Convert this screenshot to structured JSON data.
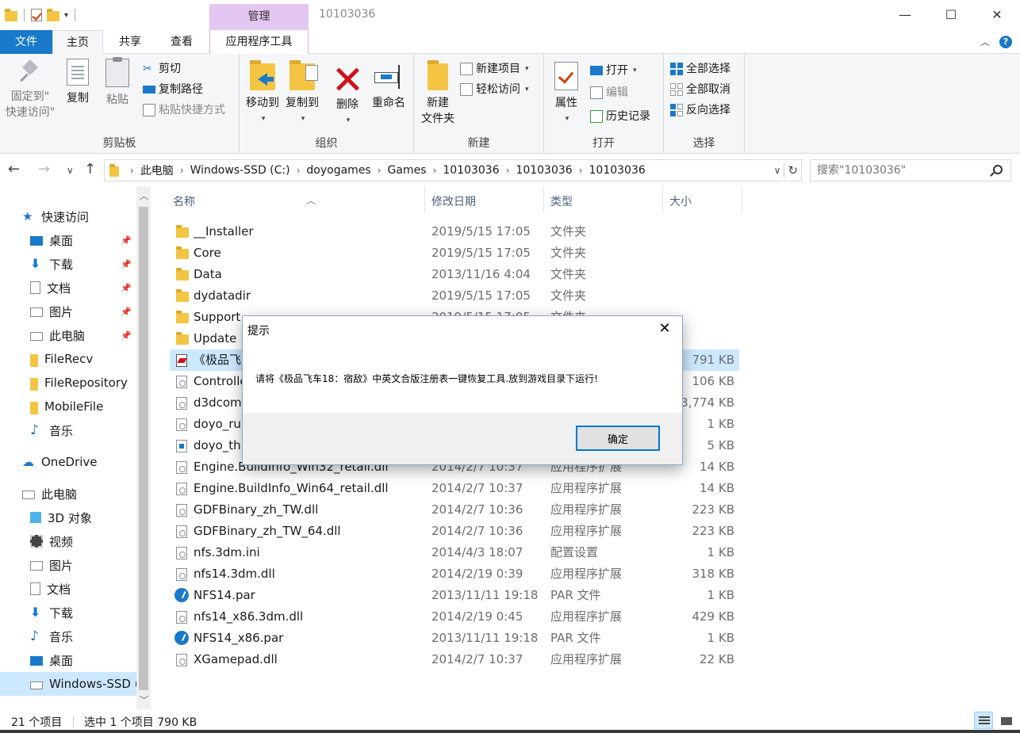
{
  "window": {
    "title": "10103036",
    "context_tab_header": "管理",
    "controls": {
      "minimize": "—",
      "maximize": "☐",
      "close": "✕"
    }
  },
  "ribbon_tabs": [
    {
      "label": "文件"
    },
    {
      "label": "主页"
    },
    {
      "label": "共享"
    },
    {
      "label": "查看"
    },
    {
      "label": "应用程序工具"
    }
  ],
  "ribbon": {
    "clipboard": {
      "label": "剪贴板",
      "pin_line1": "固定到\"",
      "pin_line2": "快速访问\"",
      "copy": "复制",
      "paste": "粘贴",
      "cut": "剪切",
      "copy_path": "复制路径",
      "paste_shortcut": "粘贴快捷方式"
    },
    "organize": {
      "label": "组织",
      "move_to": "移动到",
      "copy_to": "复制到",
      "delete": "删除",
      "rename": "重命名"
    },
    "new": {
      "label": "新建",
      "new_folder_line1": "新建",
      "new_folder_line2": "文件夹",
      "new_item": "新建项目",
      "easy_access": "轻松访问"
    },
    "open": {
      "label": "打开",
      "properties": "属性",
      "open": "打开",
      "edit": "编辑",
      "history": "历史记录"
    },
    "select": {
      "label": "选择",
      "select_all": "全部选择",
      "select_none": "全部取消",
      "invert": "反向选择"
    }
  },
  "address": {
    "crumbs": [
      "此电脑",
      "Windows-SSD (C:)",
      "doyogames",
      "Games",
      "10103036",
      "10103036",
      "10103036"
    ],
    "search_placeholder": "搜索\"10103036\""
  },
  "nav_pane": {
    "items": [
      {
        "label": "快速访问",
        "icon": "star-icon",
        "pinned": false
      },
      {
        "label": "桌面",
        "icon": "desktop-icon",
        "pinned": true
      },
      {
        "label": "下载",
        "icon": "download-icon",
        "pinned": true
      },
      {
        "label": "文档",
        "icon": "document-icon",
        "pinned": true
      },
      {
        "label": "图片",
        "icon": "picture-icon",
        "pinned": true
      },
      {
        "label": "此电脑",
        "icon": "computer-icon",
        "pinned": true
      },
      {
        "label": "FileRecv",
        "icon": "folder-icon",
        "pinned": false
      },
      {
        "label": "FileRepository",
        "icon": "folder-icon",
        "pinned": false
      },
      {
        "label": "MobileFile",
        "icon": "folder-icon",
        "pinned": false
      },
      {
        "label": "音乐",
        "icon": "music-icon",
        "pinned": false
      },
      {
        "label": "OneDrive",
        "icon": "cloud-icon",
        "pinned": false
      },
      {
        "label": "此电脑",
        "icon": "computer-icon",
        "pinned": false
      },
      {
        "label": "3D 对象",
        "icon": "cube-icon",
        "pinned": false
      },
      {
        "label": "视频",
        "icon": "video-icon",
        "pinned": false
      },
      {
        "label": "图片",
        "icon": "picture-icon",
        "pinned": false
      },
      {
        "label": "文档",
        "icon": "document-icon",
        "pinned": false
      },
      {
        "label": "下载",
        "icon": "download-icon",
        "pinned": false
      },
      {
        "label": "音乐",
        "icon": "music-icon",
        "pinned": false
      },
      {
        "label": "桌面",
        "icon": "desktop-icon",
        "pinned": false
      },
      {
        "label": "Windows-SSD (",
        "icon": "drive-icon",
        "pinned": false
      }
    ]
  },
  "file_list": {
    "columns": {
      "name": "名称",
      "date": "修改日期",
      "type": "类型",
      "size": "大小"
    },
    "rows": [
      {
        "name": "__Installer",
        "date": "2019/5/15 17:05",
        "type": "文件夹",
        "size": "",
        "icon": "folder"
      },
      {
        "name": "Core",
        "date": "2019/5/15 17:05",
        "type": "文件夹",
        "size": "",
        "icon": "folder"
      },
      {
        "name": "Data",
        "date": "2013/11/16 4:04",
        "type": "文件夹",
        "size": "",
        "icon": "folder"
      },
      {
        "name": "dydatadir",
        "date": "2019/5/15 17:05",
        "type": "文件夹",
        "size": "",
        "icon": "folder"
      },
      {
        "name": "Support",
        "date": "2019/5/15 17:05",
        "type": "文件夹",
        "size": "",
        "icon": "folder"
      },
      {
        "name": "Update",
        "date": "",
        "type": "",
        "size": "",
        "icon": "folder"
      },
      {
        "name": "《极品飞",
        "date": "",
        "type": "",
        "size": "791 KB",
        "icon": "exe"
      },
      {
        "name": "Controlle",
        "date": "",
        "type": "",
        "size": "106 KB",
        "icon": "file"
      },
      {
        "name": "d3dcom",
        "date": "",
        "type": "",
        "size": "3,774 KB",
        "icon": "file"
      },
      {
        "name": "doyo_ru",
        "date": "",
        "type": "",
        "size": "1 KB",
        "icon": "file"
      },
      {
        "name": "doyo_th",
        "date": "",
        "type": "",
        "size": "5 KB",
        "icon": "img"
      },
      {
        "name": "Engine.BuildInfo_Win32_retail.dll",
        "date": "2014/2/7 10:37",
        "type": "应用程序扩展",
        "size": "14 KB",
        "icon": "file"
      },
      {
        "name": "Engine.BuildInfo_Win64_retail.dll",
        "date": "2014/2/7 10:37",
        "type": "应用程序扩展",
        "size": "14 KB",
        "icon": "file"
      },
      {
        "name": "GDFBinary_zh_TW.dll",
        "date": "2014/2/7 10:36",
        "type": "应用程序扩展",
        "size": "223 KB",
        "icon": "file"
      },
      {
        "name": "GDFBinary_zh_TW_64.dll",
        "date": "2014/2/7 10:36",
        "type": "应用程序扩展",
        "size": "223 KB",
        "icon": "file"
      },
      {
        "name": "nfs.3dm.ini",
        "date": "2014/4/3 18:07",
        "type": "配置设置",
        "size": "1 KB",
        "icon": "file"
      },
      {
        "name": "nfs14.3dm.dll",
        "date": "2014/2/19 0:39",
        "type": "应用程序扩展",
        "size": "318 KB",
        "icon": "file"
      },
      {
        "name": "NFS14.par",
        "date": "2013/11/11 19:18",
        "type": "PAR 文件",
        "size": "1 KB",
        "icon": "par"
      },
      {
        "name": "nfs14_x86.3dm.dll",
        "date": "2014/2/19 0:45",
        "type": "应用程序扩展",
        "size": "429 KB",
        "icon": "file"
      },
      {
        "name": "NFS14_x86.par",
        "date": "2013/11/11 19:18",
        "type": "PAR 文件",
        "size": "1 KB",
        "icon": "par"
      },
      {
        "name": "XGamepad.dll",
        "date": "2014/2/7 10:37",
        "type": "应用程序扩展",
        "size": "22 KB",
        "icon": "file"
      }
    ]
  },
  "status": {
    "count": "21 个项目",
    "selection": "选中 1 个项目  790 KB"
  },
  "dialog": {
    "title": "提示",
    "message": "请将《极品飞车18：宿敌》中英文合版注册表一键恢复工具.放到游戏目录下运行!",
    "ok_label": "确定"
  }
}
